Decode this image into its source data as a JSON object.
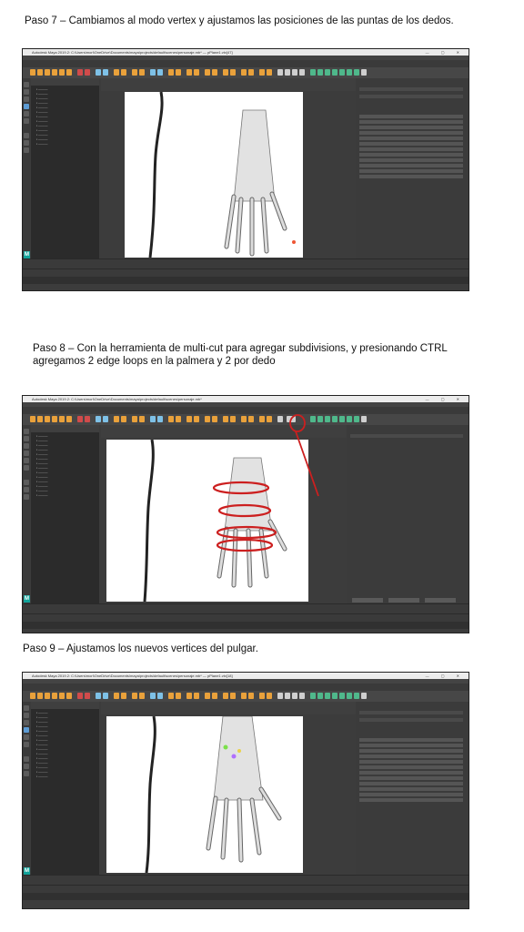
{
  "steps": [
    {
      "title": "Paso 7 – Cambiamos al modo vertex y ajustamos las posiciones de las puntas de los dedos.",
      "window_title": "Autodesk Maya 2019.2: C:\\Users\\mori\\OneDrive\\Documents\\maya\\projects\\default\\scenes\\personaje.mb*   —   pPlane1.vtx[47]",
      "window_controls": "— ▢ ✕"
    },
    {
      "title": "Paso 8 – Con la herramienta de multi-cut para agregar subdivisions, y presionando CTRL agregamos 2 edge loops en la palmera y 2 por dedo",
      "window_title": "Autodesk Maya 2019.2: C:\\Users\\mori\\OneDrive\\Documents\\maya\\projects\\default\\scenes\\personaje.mb*",
      "window_controls": "— ▢ ✕"
    },
    {
      "title": "Paso 9 – Ajustamos los nuevos vertices del pulgar.",
      "window_title": "Autodesk Maya 2019.2: C:\\Users\\mori\\OneDrive\\Documents\\maya\\projects\\default\\scenes\\personaje.mb*   —   pPlane1.vtx[18]",
      "window_controls": "— ▢ ✕"
    }
  ],
  "colors": {
    "maya_dark": "#3c3c3c",
    "maya_outliner": "#2b2b2b",
    "maya_teal": "#11a39a",
    "annotation_red": "#cc1f1f",
    "vertex_green": "#7be04a",
    "vertex_purple": "#b070ff"
  },
  "icons": [
    "maya-logo-icon",
    "window-minimize-icon",
    "window-maximize-icon",
    "window-close-icon"
  ]
}
